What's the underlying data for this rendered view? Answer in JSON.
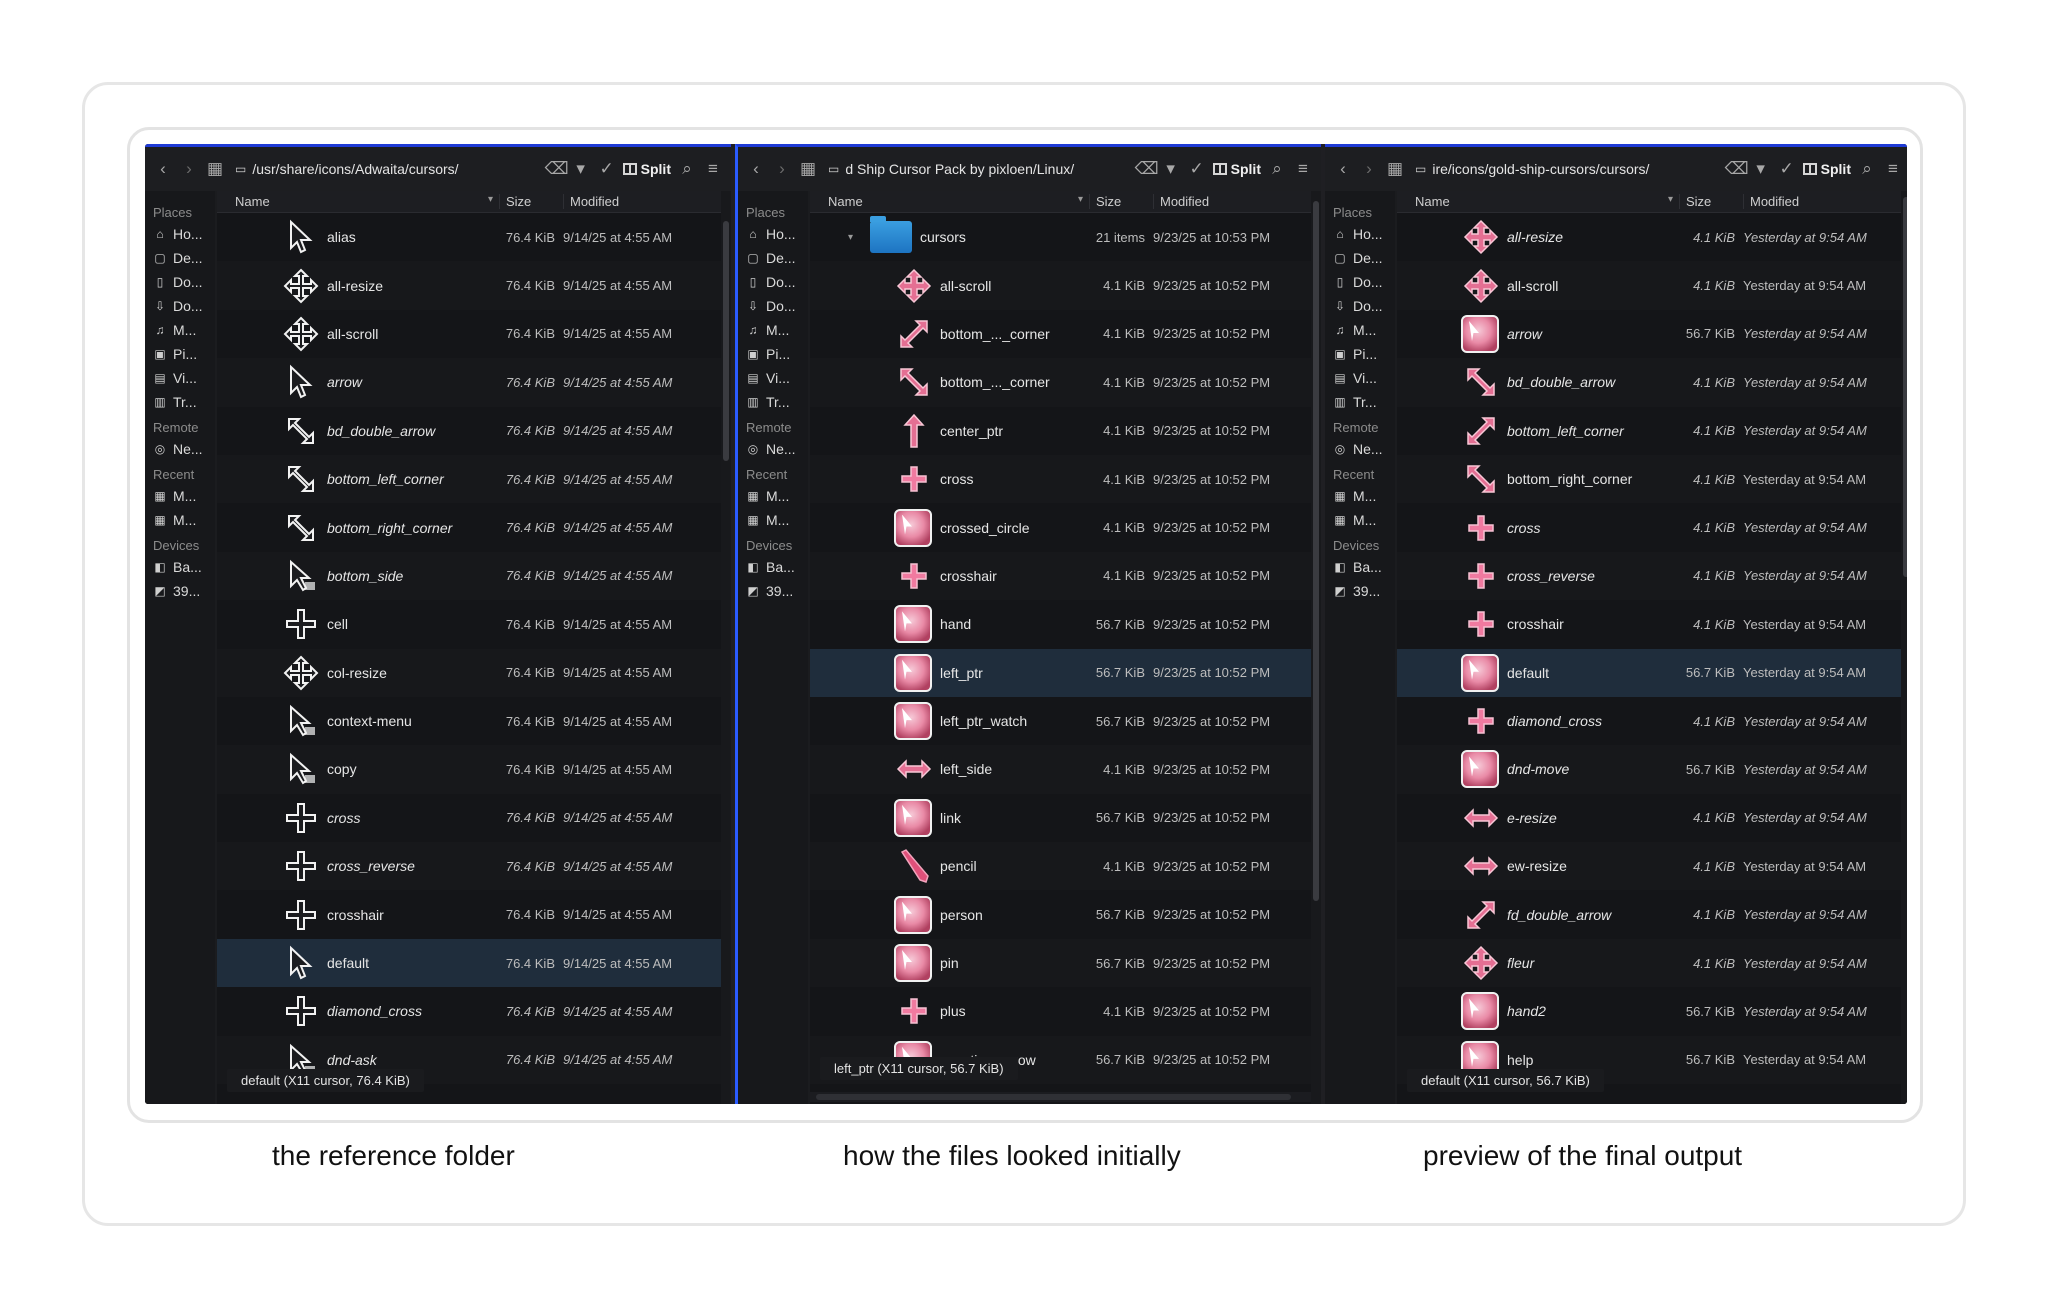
{
  "captions": [
    "the reference folder",
    "how the files looked initially",
    "preview of the final output"
  ],
  "sidebar": {
    "places_label": "Places",
    "remote_label": "Remote",
    "recent_label": "Recent",
    "devices_label": "Devices",
    "places": [
      "Ho...",
      "De...",
      "Do...",
      "Do...",
      "M...",
      "Pi...",
      "Vi...",
      "Tr..."
    ],
    "remote": [
      "Ne..."
    ],
    "recent": [
      "M...",
      "M..."
    ],
    "devices": [
      "Ba...",
      "39..."
    ]
  },
  "split_label": "Split",
  "columns": {
    "name": "Name",
    "size": "Size",
    "modified": "Modified"
  },
  "panes": [
    {
      "path": "/usr/share/icons/Adwaita/cursors/",
      "status": "default (X11 cursor, 76.4 KiB)",
      "rows": [
        {
          "name": "alias",
          "size": "76.4 KiB",
          "mod": "9/14/25 at 4:55 AM"
        },
        {
          "name": "all-resize",
          "size": "76.4 KiB",
          "mod": "9/14/25 at 4:55 AM"
        },
        {
          "name": "all-scroll",
          "size": "76.4 KiB",
          "mod": "9/14/25 at 4:55 AM"
        },
        {
          "name": "arrow",
          "size": "76.4 KiB",
          "mod": "9/14/25 at 4:55 AM"
        },
        {
          "name": "bd_double_arrow",
          "size": "76.4 KiB",
          "mod": "9/14/25 at 4:55 AM"
        },
        {
          "name": "bottom_left_corner",
          "size": "76.4 KiB",
          "mod": "9/14/25 at 4:55 AM"
        },
        {
          "name": "bottom_right_corner",
          "size": "76.4 KiB",
          "mod": "9/14/25 at 4:55 AM"
        },
        {
          "name": "bottom_side",
          "size": "76.4 KiB",
          "mod": "9/14/25 at 4:55 AM"
        },
        {
          "name": "cell",
          "size": "76.4 KiB",
          "mod": "9/14/25 at 4:55 AM"
        },
        {
          "name": "col-resize",
          "size": "76.4 KiB",
          "mod": "9/14/25 at 4:55 AM"
        },
        {
          "name": "context-menu",
          "size": "76.4 KiB",
          "mod": "9/14/25 at 4:55 AM"
        },
        {
          "name": "copy",
          "size": "76.4 KiB",
          "mod": "9/14/25 at 4:55 AM"
        },
        {
          "name": "cross",
          "size": "76.4 KiB",
          "mod": "9/14/25 at 4:55 AM"
        },
        {
          "name": "cross_reverse",
          "size": "76.4 KiB",
          "mod": "9/14/25 at 4:55 AM"
        },
        {
          "name": "crosshair",
          "size": "76.4 KiB",
          "mod": "9/14/25 at 4:55 AM"
        },
        {
          "name": "default",
          "size": "76.4 KiB",
          "mod": "9/14/25 at 4:55 AM"
        },
        {
          "name": "diamond_cross",
          "size": "76.4 KiB",
          "mod": "9/14/25 at 4:55 AM"
        },
        {
          "name": "dnd-ask",
          "size": "76.4 KiB",
          "mod": "9/14/25 at 4:55 AM"
        }
      ]
    },
    {
      "path": "d Ship Cursor Pack by pixloen/Linux/",
      "status": "left_ptr (X11 cursor, 56.7 KiB)",
      "rows": [
        {
          "name": "cursors",
          "size": "21 items",
          "mod": "9/23/25 at 10:53 PM"
        },
        {
          "name": "all-scroll",
          "size": "4.1 KiB",
          "mod": "9/23/25 at 10:52 PM"
        },
        {
          "name": "bottom_..._corner",
          "size": "4.1 KiB",
          "mod": "9/23/25 at 10:52 PM"
        },
        {
          "name": "bottom_..._corner",
          "size": "4.1 KiB",
          "mod": "9/23/25 at 10:52 PM"
        },
        {
          "name": "center_ptr",
          "size": "4.1 KiB",
          "mod": "9/23/25 at 10:52 PM"
        },
        {
          "name": "cross",
          "size": "4.1 KiB",
          "mod": "9/23/25 at 10:52 PM"
        },
        {
          "name": "crossed_circle",
          "size": "4.1 KiB",
          "mod": "9/23/25 at 10:52 PM"
        },
        {
          "name": "crosshair",
          "size": "4.1 KiB",
          "mod": "9/23/25 at 10:52 PM"
        },
        {
          "name": "hand",
          "size": "56.7 KiB",
          "mod": "9/23/25 at 10:52 PM"
        },
        {
          "name": "left_ptr",
          "size": "56.7 KiB",
          "mod": "9/23/25 at 10:52 PM"
        },
        {
          "name": "left_ptr_watch",
          "size": "56.7 KiB",
          "mod": "9/23/25 at 10:52 PM"
        },
        {
          "name": "left_side",
          "size": "4.1 KiB",
          "mod": "9/23/25 at 10:52 PM"
        },
        {
          "name": "link",
          "size": "56.7 KiB",
          "mod": "9/23/25 at 10:52 PM"
        },
        {
          "name": "pencil",
          "size": "4.1 KiB",
          "mod": "9/23/25 at 10:52 PM"
        },
        {
          "name": "person",
          "size": "56.7 KiB",
          "mod": "9/23/25 at 10:52 PM"
        },
        {
          "name": "pin",
          "size": "56.7 KiB",
          "mod": "9/23/25 at 10:52 PM"
        },
        {
          "name": "plus",
          "size": "4.1 KiB",
          "mod": "9/23/25 at 10:52 PM"
        },
        {
          "name": "question_arrow",
          "size": "56.7 KiB",
          "mod": "9/23/25 at 10:52 PM"
        }
      ]
    },
    {
      "path": "ire/icons/gold-ship-cursors/cursors/",
      "status": "default (X11 cursor, 56.7 KiB)",
      "rows": [
        {
          "name": "all-resize",
          "size": "4.1 KiB",
          "mod": "Yesterday at 9:54 AM"
        },
        {
          "name": "all-scroll",
          "size": "4.1 KiB",
          "mod": "Yesterday at 9:54 AM"
        },
        {
          "name": "arrow",
          "size": "56.7 KiB",
          "mod": "Yesterday at 9:54 AM"
        },
        {
          "name": "bd_double_arrow",
          "size": "4.1 KiB",
          "mod": "Yesterday at 9:54 AM"
        },
        {
          "name": "bottom_left_corner",
          "size": "4.1 KiB",
          "mod": "Yesterday at 9:54 AM"
        },
        {
          "name": "bottom_right_corner",
          "size": "4.1 KiB",
          "mod": "Yesterday at 9:54 AM"
        },
        {
          "name": "cross",
          "size": "4.1 KiB",
          "mod": "Yesterday at 9:54 AM"
        },
        {
          "name": "cross_reverse",
          "size": "4.1 KiB",
          "mod": "Yesterday at 9:54 AM"
        },
        {
          "name": "crosshair",
          "size": "4.1 KiB",
          "mod": "Yesterday at 9:54 AM"
        },
        {
          "name": "default",
          "size": "56.7 KiB",
          "mod": "Yesterday at 9:54 AM"
        },
        {
          "name": "diamond_cross",
          "size": "4.1 KiB",
          "mod": "Yesterday at 9:54 AM"
        },
        {
          "name": "dnd-move",
          "size": "56.7 KiB",
          "mod": "Yesterday at 9:54 AM"
        },
        {
          "name": "e-resize",
          "size": "4.1 KiB",
          "mod": "Yesterday at 9:54 AM"
        },
        {
          "name": "ew-resize",
          "size": "4.1 KiB",
          "mod": "Yesterday at 9:54 AM"
        },
        {
          "name": "fd_double_arrow",
          "size": "4.1 KiB",
          "mod": "Yesterday at 9:54 AM"
        },
        {
          "name": "fleur",
          "size": "4.1 KiB",
          "mod": "Yesterday at 9:54 AM"
        },
        {
          "name": "hand2",
          "size": "56.7 KiB",
          "mod": "Yesterday at 9:54 AM"
        },
        {
          "name": "help",
          "size": "56.7 KiB",
          "mod": "Yesterday at 9:54 AM"
        }
      ]
    }
  ]
}
